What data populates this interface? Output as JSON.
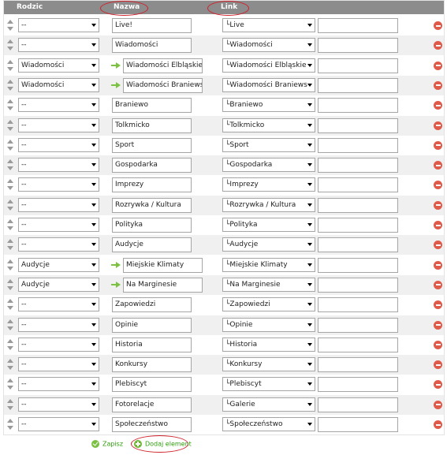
{
  "header": {
    "col_parent": "Rodzic",
    "col_name": "Nazwa",
    "col_link": "Link"
  },
  "link_prefix": "└",
  "rows": [
    {
      "parent": "--",
      "name": "Live!",
      "link": "Live",
      "child": false
    },
    {
      "parent": "--",
      "name": "Wiadomości",
      "link": "Wiadomości",
      "child": false
    },
    {
      "parent": "Wiadomości",
      "name": "Wiadomości Elbląskie",
      "link": "Wiadomości Elbląskie",
      "child": true
    },
    {
      "parent": "Wiadomości",
      "name": "Wiadomości Braniewsk",
      "link": "Wiadomości Braniews",
      "child": true
    },
    {
      "parent": "--",
      "name": "Braniewo",
      "link": "Braniewo",
      "child": false
    },
    {
      "parent": "--",
      "name": "Tolkmicko",
      "link": "Tolkmicko",
      "child": false
    },
    {
      "parent": "--",
      "name": "Sport",
      "link": "Sport",
      "child": false
    },
    {
      "parent": "--",
      "name": "Gospodarka",
      "link": "Gospodarka",
      "child": false
    },
    {
      "parent": "--",
      "name": "Imprezy",
      "link": "Imprezy",
      "child": false
    },
    {
      "parent": "--",
      "name": "Rozrywka / Kultura",
      "link": "Rozrywka / Kultura",
      "child": false
    },
    {
      "parent": "--",
      "name": "Polityka",
      "link": "Polityka",
      "child": false
    },
    {
      "parent": "--",
      "name": "Audycje",
      "link": "Audycje",
      "child": false
    },
    {
      "parent": "Audycje",
      "name": "Miejskie Klimaty",
      "link": "Miejskie Klimaty",
      "child": true
    },
    {
      "parent": "Audycje",
      "name": "Na Marginesie",
      "link": "Na Marginesie",
      "child": true
    },
    {
      "parent": "--",
      "name": "Zapowiedzi",
      "link": "Zapowiedzi",
      "child": false
    },
    {
      "parent": "--",
      "name": "Opinie",
      "link": "Opinie",
      "child": false
    },
    {
      "parent": "--",
      "name": "Historia",
      "link": "Historia",
      "child": false
    },
    {
      "parent": "--",
      "name": "Konkursy",
      "link": "Konkursy",
      "child": false
    },
    {
      "parent": "--",
      "name": "Plebiscyt",
      "link": "Plebiscyt",
      "child": false
    },
    {
      "parent": "--",
      "name": "Fotorelacje",
      "link": "Galerie",
      "child": false
    },
    {
      "parent": "--",
      "name": "Społeczeństwo",
      "link": "Społeczeństwo",
      "child": false
    }
  ],
  "footer": {
    "save_label": "Zapisz",
    "add_label": "Dodaj element"
  },
  "colors": {
    "header_bg": "#8c8c8c",
    "accent_green": "#2f9e0d",
    "delete_red": "#e05a4a",
    "annotation_red": "#d0202a"
  }
}
